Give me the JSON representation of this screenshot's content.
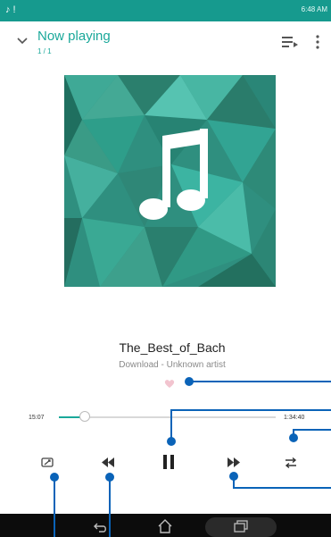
{
  "header": {
    "title": "Now playing",
    "subtitle": "1 / 1"
  },
  "track": {
    "title": "The_Best_of_Bach",
    "subtitle": "Download - Unknown artist"
  },
  "progress": {
    "elapsed": "15:07",
    "total": "1:34:40",
    "fraction": 0.12
  },
  "status_bar": {
    "time": "6:48 AM"
  },
  "colors": {
    "accent": "#1aa89a",
    "status": "#169a8e",
    "callout": "#0a63b8"
  }
}
